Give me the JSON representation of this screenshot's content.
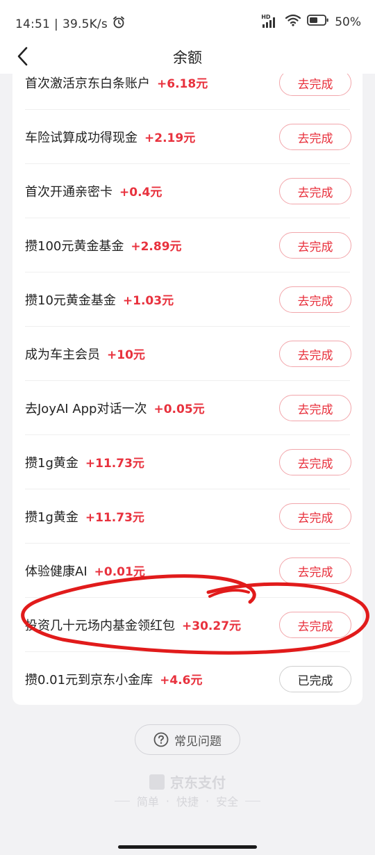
{
  "status_bar": {
    "time": "14:51",
    "separator": "|",
    "speed": "39.5K/s",
    "battery": "50%",
    "network_badge": "HD"
  },
  "nav": {
    "title": "余额"
  },
  "tasks": [
    {
      "label": "首次激活京东白条账户",
      "reward": "+6.18元",
      "button": "去完成",
      "done": false
    },
    {
      "label": "车险试算成功得现金",
      "reward": "+2.19元",
      "button": "去完成",
      "done": false
    },
    {
      "label": "首次开通亲密卡",
      "reward": "+0.4元",
      "button": "去完成",
      "done": false
    },
    {
      "label": "攒100元黄金基金",
      "reward": "+2.89元",
      "button": "去完成",
      "done": false
    },
    {
      "label": "攒10元黄金基金",
      "reward": "+1.03元",
      "button": "去完成",
      "done": false
    },
    {
      "label": "成为车主会员",
      "reward": "+10元",
      "button": "去完成",
      "done": false
    },
    {
      "label": "去JoyAI App对话一次",
      "reward": "+0.05元",
      "button": "去完成",
      "done": false
    },
    {
      "label": "攒1g黄金",
      "reward": "+11.73元",
      "button": "去完成",
      "done": false
    },
    {
      "label": "攒1g黄金",
      "reward": "+11.73元",
      "button": "去完成",
      "done": false
    },
    {
      "label": "体验健康AI",
      "reward": "+0.01元",
      "button": "去完成",
      "done": false
    },
    {
      "label": "投资几十元场内基金领红包",
      "reward": "+30.27元",
      "button": "去完成",
      "done": false
    },
    {
      "label": "攒0.01元到京东小金库",
      "reward": "+4.6元",
      "button": "已完成",
      "done": true
    }
  ],
  "faq": {
    "label": "常见问题"
  },
  "footer": {
    "brand": "京东支付",
    "slogan": [
      "简单",
      "·",
      "快捷",
      "·",
      "安全"
    ]
  },
  "colors": {
    "accent_red": "#e8313d",
    "annotation_red": "#e11b1b"
  }
}
